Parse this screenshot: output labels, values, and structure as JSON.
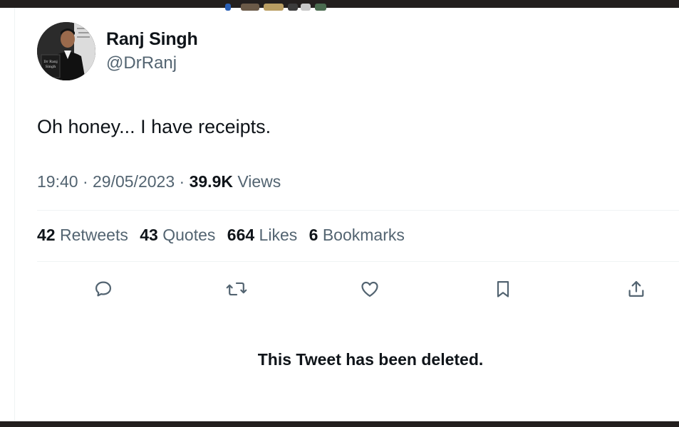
{
  "tweet": {
    "author": {
      "display_name": "Ranj Singh",
      "handle": "@DrRanj",
      "avatar_caption": "Dr Ranj Singh"
    },
    "text": "Oh honey... I have receipts.",
    "time": "19:40",
    "date": "29/05/2023",
    "separator": "·",
    "views_count": "39.9K",
    "views_label": "Views"
  },
  "stats": [
    {
      "count": "42",
      "label": "Retweets"
    },
    {
      "count": "43",
      "label": "Quotes"
    },
    {
      "count": "664",
      "label": "Likes"
    },
    {
      "count": "6",
      "label": "Bookmarks"
    }
  ],
  "actions": {
    "icons": [
      "reply-icon",
      "retweet-icon",
      "like-icon",
      "bookmark-icon",
      "share-icon"
    ],
    "icon_color": "#536471"
  },
  "deleted_notice": "This Tweet has been deleted.",
  "colors": {
    "primary_text": "#0f1419",
    "secondary_text": "#536471",
    "divider": "#eff3f4",
    "frame": "#231f1e"
  }
}
